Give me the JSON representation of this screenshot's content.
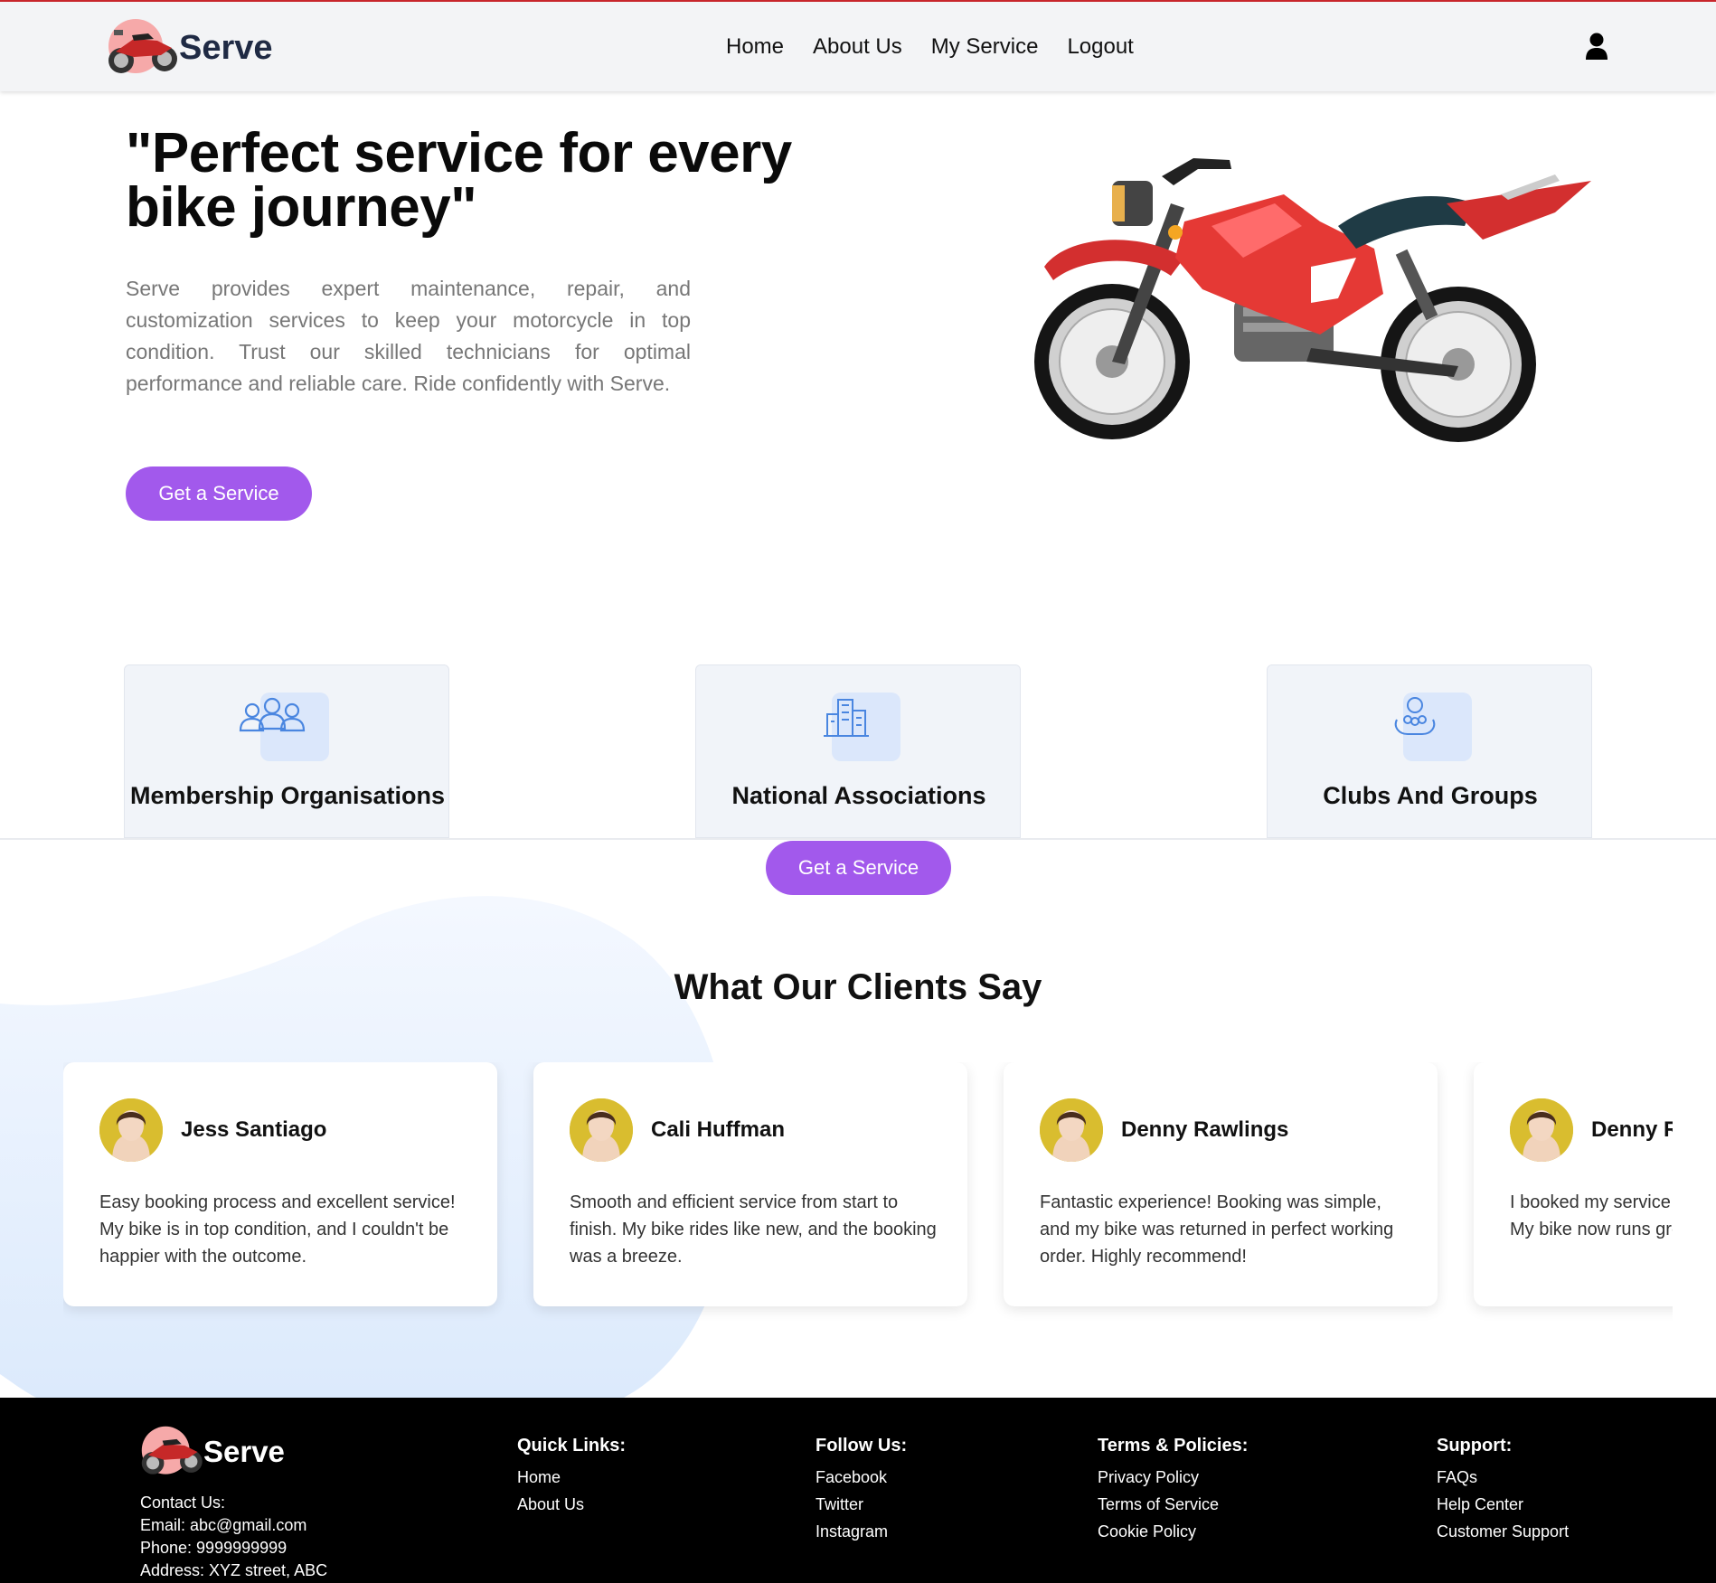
{
  "nav": {
    "brand": "Serve",
    "links": [
      "Home",
      "About Us",
      "My Service",
      "Logout"
    ]
  },
  "hero": {
    "title": "\"Perfect service for every bike journey\"",
    "description": "Serve provides expert maintenance, repair, and customization services to keep your motorcycle in top condition. Trust our skilled technicians for optimal performance and reliable care. Ride confidently with Serve.",
    "button": "Get a Service"
  },
  "features": [
    {
      "title": "Membership Organisations",
      "icon": "people-group-icon"
    },
    {
      "title": "National Associations",
      "icon": "buildings-icon"
    },
    {
      "title": "Clubs And Groups",
      "icon": "hands-group-icon"
    }
  ],
  "mid_button": "Get a Service",
  "testimonials": {
    "title": "What Our Clients Say",
    "items": [
      {
        "name": "Jess Santiago",
        "text": "Easy booking process and excellent service! My bike is in top condition, and I couldn't be happier with the outcome."
      },
      {
        "name": "Cali Huffman",
        "text": "Smooth and efficient service from start to finish. My bike rides like new, and the booking was a breeze."
      },
      {
        "name": "Denny Rawlings",
        "text": "Fantastic experience! Booking was simple, and my bike was returned in perfect working order. Highly recommend!"
      },
      {
        "name": "Denny Rawlings",
        "text": "I booked my service online and it was worth it. My bike now runs great, great job!"
      }
    ]
  },
  "footer": {
    "brand": "Serve",
    "contact": {
      "label": "Contact Us:",
      "email": "Email: abc@gmail.com",
      "phone": "Phone: 9999999999",
      "address": "Address: XYZ street, ABC"
    },
    "quick_links": {
      "heading": "Quick Links:",
      "items": [
        "Home",
        "About Us"
      ]
    },
    "follow": {
      "heading": "Follow Us:",
      "items": [
        "Facebook",
        "Twitter",
        "Instagram"
      ]
    },
    "terms": {
      "heading": "Terms & Policies:",
      "items": [
        "Privacy Policy",
        "Terms of Service",
        "Cookie Policy"
      ]
    },
    "support": {
      "heading": "Support:",
      "items": [
        "FAQs",
        "Help Center",
        "Customer Support"
      ]
    }
  },
  "colors": {
    "accent": "#a259ec",
    "nav_bg": "#f3f4f6",
    "footer_bg": "#000000",
    "card_bg": "#f1f4f9"
  }
}
